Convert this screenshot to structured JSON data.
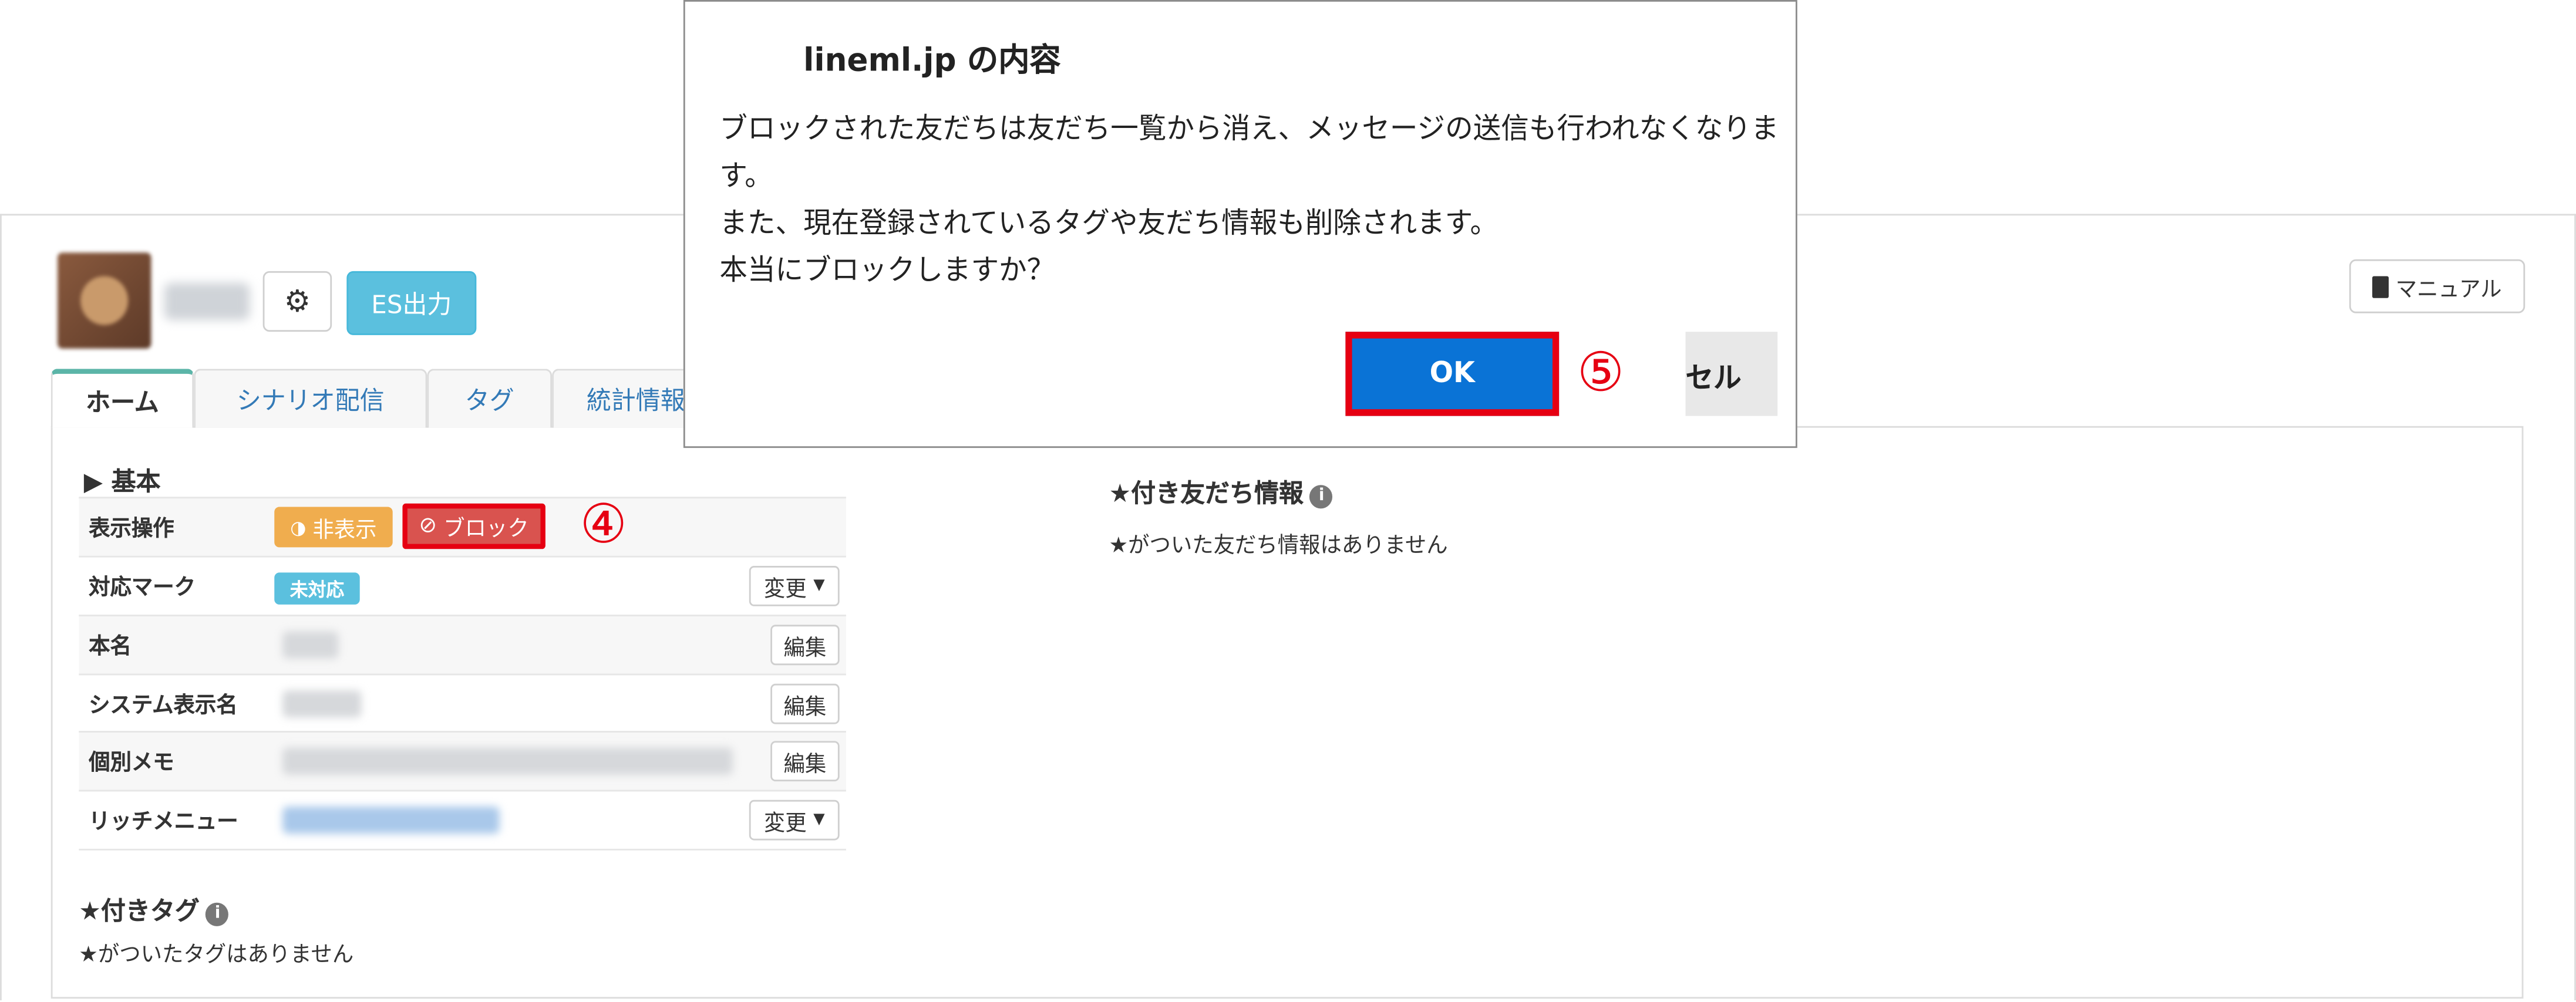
{
  "header": {
    "es_button": "ES出力",
    "manual_button": "マニュアル"
  },
  "tabs": [
    {
      "label": "ホーム"
    },
    {
      "label": "シナリオ配信"
    },
    {
      "label": "タグ"
    },
    {
      "label": "統計情報"
    }
  ],
  "basic": {
    "heading": "▶ 基本",
    "rows": [
      {
        "label": "表示操作"
      },
      {
        "label": "対応マーク"
      },
      {
        "label": "本名"
      },
      {
        "label": "システム表示名"
      },
      {
        "label": "個別メモ"
      },
      {
        "label": "リッチメニュー"
      }
    ],
    "hide_button": "非表示",
    "block_button": "ブロック",
    "badge": "未対応",
    "change_label": "変更",
    "edit_label": "編集"
  },
  "annotations": {
    "step4": "④",
    "step5": "⑤"
  },
  "tags_section": {
    "heading": "★付きタグ",
    "empty": "★がついたタグはありません"
  },
  "friend_info_section": {
    "heading": "★付き友だち情報",
    "empty": "★がついた友だち情報はありません"
  },
  "dialog": {
    "title": "lineml.jp の内容",
    "lines": [
      "ブロックされた友だちは友だち一覧から消え、メッセージの送信も行われなくなりま",
      "す。",
      "また、現在登録されているタグや友だち情報も削除されます。",
      "本当にブロックしますか？"
    ],
    "ok_button": "OK",
    "cancel_button": "セル"
  },
  "colors": {
    "accent_info": "#5bc0de",
    "warning": "#f0ad4e",
    "danger": "#d9534f",
    "highlight_red": "#e60012",
    "dialog_primary": "#0a73d6"
  }
}
